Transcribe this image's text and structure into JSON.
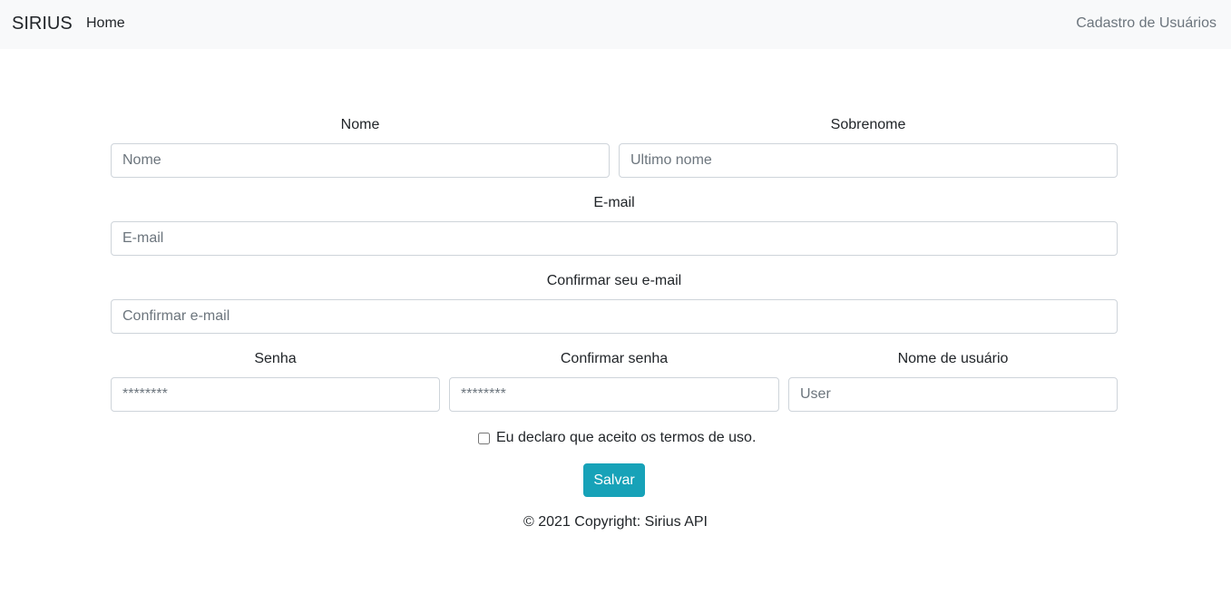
{
  "navbar": {
    "brand": "SIRIUS",
    "home_label": "Home",
    "right_label": "Cadastro de Usuários"
  },
  "form": {
    "first_name": {
      "label": "Nome",
      "placeholder": "Nome"
    },
    "last_name": {
      "label": "Sobrenome",
      "placeholder": "Ultimo nome"
    },
    "email": {
      "label": "E-mail",
      "placeholder": "E-mail"
    },
    "confirm_email": {
      "label": "Confirmar seu e-mail",
      "placeholder": "Confirmar e-mail"
    },
    "password": {
      "label": "Senha",
      "placeholder": "********"
    },
    "confirm_password": {
      "label": "Confirmar senha",
      "placeholder": "********"
    },
    "username": {
      "label": "Nome de usuário",
      "placeholder": "User"
    },
    "terms_label": "Eu declaro que aceito os termos de uso.",
    "save_label": "Salvar"
  },
  "footer": {
    "text": "© 2021 Copyright: Sirius API"
  }
}
